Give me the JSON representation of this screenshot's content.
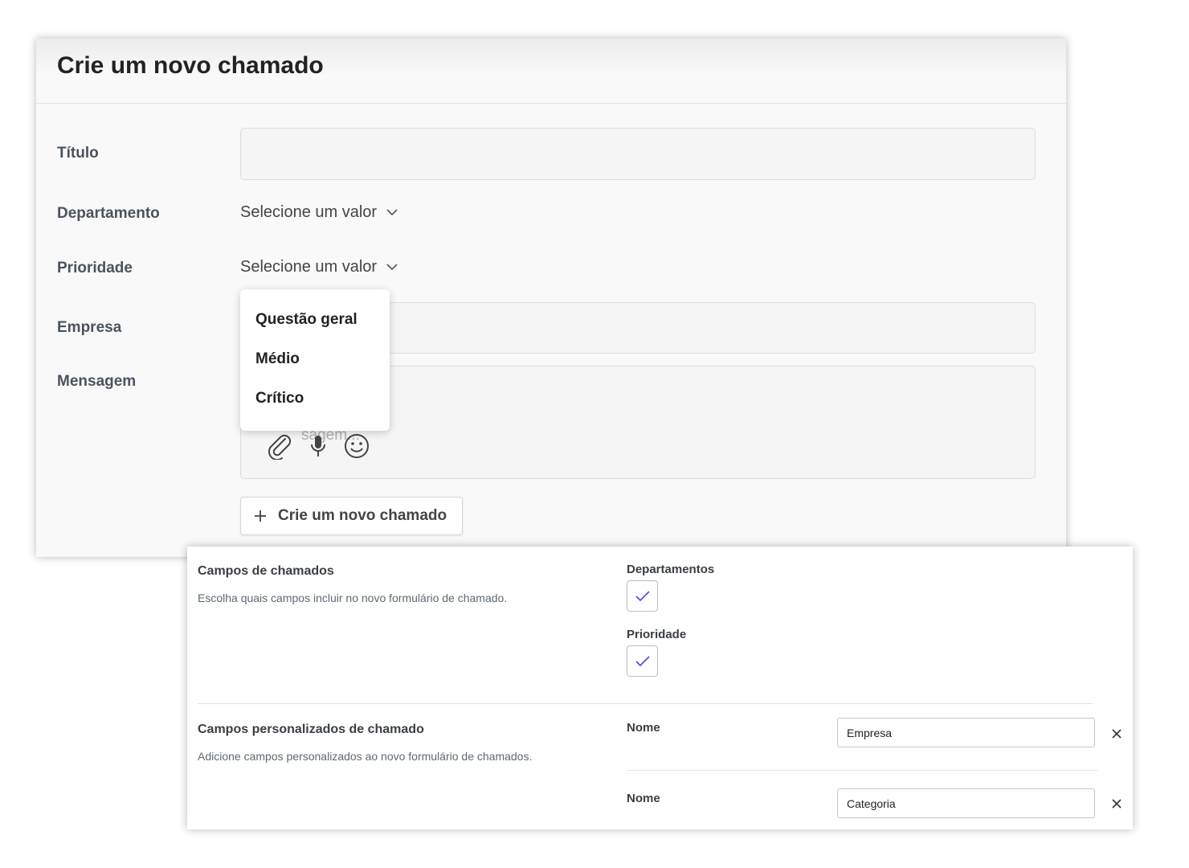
{
  "ticket_form": {
    "title": "Crie um novo chamado",
    "fields": {
      "titulo_label": "Título",
      "departamento_label": "Departamento",
      "departamento_value": "Selecione um valor",
      "prioridade_label": "Prioridade",
      "prioridade_value": "Selecione um valor",
      "empresa_label": "Empresa",
      "mensagem_label": "Mensagem",
      "mensagem_placeholder_visible": "sagem..."
    },
    "priority_dropdown": {
      "options": [
        "Questão geral",
        "Médio",
        "Crítico"
      ]
    },
    "message_icons": [
      "paperclip-icon",
      "microphone-icon",
      "smiley-icon"
    ],
    "submit_button": {
      "icon": "plus-icon",
      "label": "Crie um novo chamado"
    }
  },
  "settings": {
    "ticket_fields": {
      "title": "Campos de chamados",
      "description": "Escolha quais campos incluir no novo formulário de chamado.",
      "options": [
        {
          "label": "Departamentos",
          "checked": true
        },
        {
          "label": "Prioridade",
          "checked": true
        }
      ]
    },
    "custom_fields": {
      "title": "Campos personalizados de chamado",
      "description": "Adicione campos personalizados ao novo formulário de chamados.",
      "rows": [
        {
          "label": "Nome",
          "value": "Empresa"
        },
        {
          "label": "Nome",
          "value": "Categoria"
        }
      ]
    }
  },
  "colors": {
    "check_accent": "#5b3fe4",
    "card_bg": "#f9f9f9"
  }
}
